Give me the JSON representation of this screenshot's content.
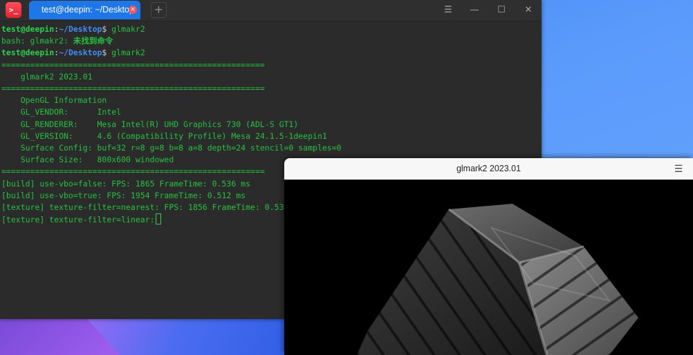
{
  "terminal": {
    "app_icon_glyph": ">_",
    "tab_title": "test@deepin: ~/Desktop",
    "tab_close_glyph": "×",
    "add_tab_glyph": "+",
    "window_buttons": {
      "menu": "☰",
      "minimize": "—",
      "maximize": "☐",
      "close": "✕"
    },
    "prompt": {
      "user": "test@deepin",
      "sep": ":",
      "path": "~/Desktop",
      "symbol": "$"
    },
    "lines": {
      "cmd1": " glmakr2",
      "err_prefix": "bash: glmakr2: ",
      "err_msg": "未找到命令",
      "cmd2": " glmark2",
      "rule1": "=======================================================",
      "title": "    glmark2 2023.01",
      "rule2": "=======================================================",
      "gl_info": "    OpenGL Information",
      "vendor": "    GL_VENDOR:      Intel",
      "renderer": "    GL_RENDERER:    Mesa Intel(R) UHD Graphics 730 (ADL-S GT1)",
      "version": "    GL_VERSION:     4.6 (Compatibility Profile) Mesa 24.1.5-1deepin1",
      "surface_config": "    Surface Config: buf=32 r=8 g=8 b=8 a=8 depth=24 stencil=0 samples=0",
      "surface_size": "    Surface Size:   800x600 windowed",
      "rule3": "=======================================================",
      "build1": "[build] use-vbo=false: FPS: 1865 FrameTime: 0.536 ms",
      "build2": "[build] use-vbo=true: FPS: 1954 FrameTime: 0.512 ms",
      "texture1": "[texture] texture-filter=nearest: FPS: 1856 FrameTime: 0.53",
      "texture2": "[texture] texture-filter=linear:"
    }
  },
  "glmark_window": {
    "title": "glmark2 2023.01",
    "menu_glyph": "☰"
  },
  "colors": {
    "terminal_bg": "#2b2b2b",
    "terminal_text": "#23c33e",
    "prompt_path": "#3f8df5",
    "tab_active": "#1d77e8",
    "desktop": "#5b9bfb"
  }
}
